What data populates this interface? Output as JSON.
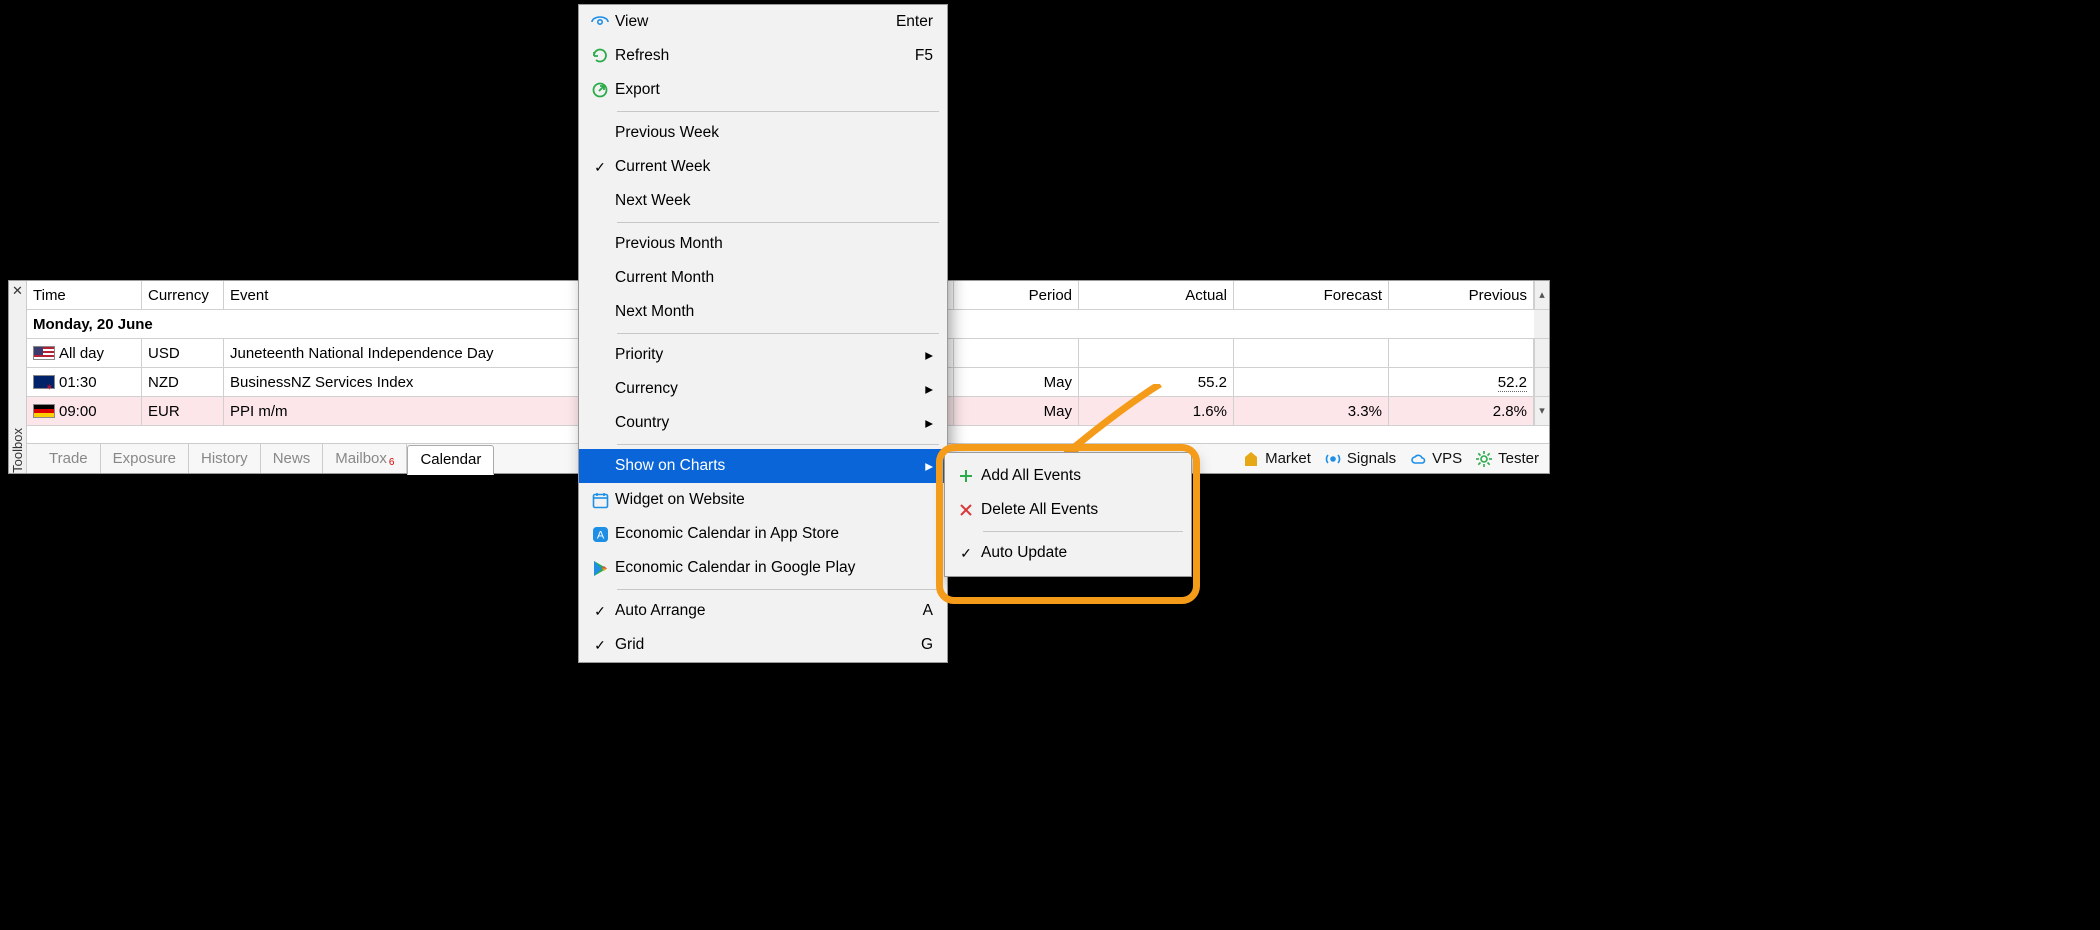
{
  "toolbox": {
    "panel_label": "Toolbox",
    "columns": {
      "time": "Time",
      "currency": "Currency",
      "event": "Event",
      "period": "Period",
      "actual": "Actual",
      "forecast": "Forecast",
      "previous": "Previous"
    },
    "date_header": "Monday, 20 June",
    "rows": [
      {
        "flag": "us",
        "time": "All day",
        "currency": "USD",
        "event": "Juneteenth National Independence Day",
        "period": "",
        "actual": "",
        "forecast": "",
        "previous": ""
      },
      {
        "flag": "nz",
        "time": "01:30",
        "currency": "NZD",
        "event": "BusinessNZ Services Index",
        "period": "May",
        "actual": "55.2",
        "forecast": "",
        "previous": "52.2",
        "prev_dotted": true
      },
      {
        "flag": "de",
        "time": "09:00",
        "currency": "EUR",
        "event": "PPI m/m",
        "period": "May",
        "actual": "1.6%",
        "forecast": "3.3%",
        "previous": "2.8%",
        "pink": true
      }
    ],
    "tabs": [
      "Trade",
      "Exposure",
      "History",
      "News",
      "Mailbox",
      "Calendar"
    ],
    "active_tab": "Calendar",
    "mailbox_badge": "6",
    "services": [
      {
        "icon": "market",
        "label": "Market",
        "color": "#e6a817"
      },
      {
        "icon": "signals",
        "label": "Signals",
        "color": "#1f8fe6"
      },
      {
        "icon": "vps",
        "label": "VPS",
        "color": "#1f8fe6"
      },
      {
        "icon": "tester",
        "label": "Tester",
        "color": "#2bab4a"
      }
    ]
  },
  "context_menu": {
    "items": [
      {
        "icon": "view",
        "label": "View",
        "shortcut": "Enter"
      },
      {
        "icon": "refresh",
        "label": "Refresh",
        "shortcut": "F5"
      },
      {
        "icon": "export",
        "label": "Export"
      },
      {
        "sep": true
      },
      {
        "label": "Previous Week"
      },
      {
        "check": true,
        "label": "Current Week"
      },
      {
        "label": "Next Week"
      },
      {
        "sep": true
      },
      {
        "label": "Previous Month"
      },
      {
        "label": "Current Month"
      },
      {
        "label": "Next Month"
      },
      {
        "sep": true
      },
      {
        "label": "Priority",
        "submenu": true
      },
      {
        "label": "Currency",
        "submenu": true
      },
      {
        "label": "Country",
        "submenu": true
      },
      {
        "sep": true
      },
      {
        "label": "Show on Charts",
        "submenu": true,
        "highlighted": true
      },
      {
        "icon": "widget",
        "label": "Widget on Website"
      },
      {
        "icon": "appstore",
        "label": "Economic Calendar in App Store"
      },
      {
        "icon": "play",
        "label": "Economic Calendar in Google Play"
      },
      {
        "sep": true
      },
      {
        "check": true,
        "label": "Auto Arrange",
        "shortcut": "A"
      },
      {
        "check": true,
        "label": "Grid",
        "shortcut": "G"
      }
    ],
    "submenu": [
      {
        "icon": "plus",
        "label": "Add All Events"
      },
      {
        "icon": "xred",
        "label": "Delete All Events"
      },
      {
        "sep": true
      },
      {
        "check": true,
        "label": "Auto Update"
      }
    ]
  }
}
